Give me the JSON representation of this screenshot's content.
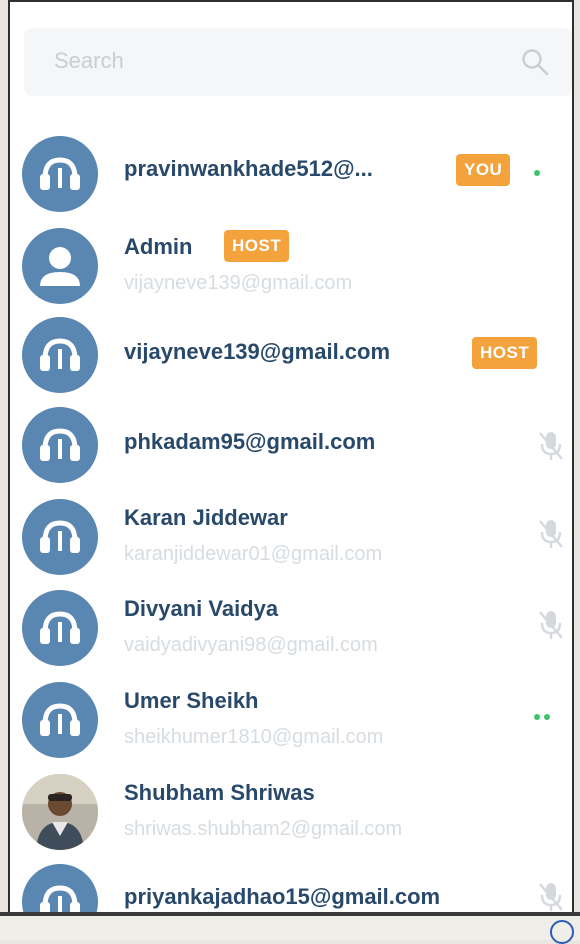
{
  "search": {
    "placeholder": "Search",
    "icon": "search-icon"
  },
  "participants": [
    {
      "name": "pravinwankhade512@...",
      "email": "",
      "badge": "YOU",
      "status": "green-dot",
      "avatar": "headset"
    },
    {
      "name": "Admin",
      "email": "vijayneve139@gmail.com",
      "badge": "HOST",
      "status": "",
      "avatar": "person"
    },
    {
      "name": "vijayneve139@gmail.com",
      "email": "",
      "badge": "HOST",
      "status": "",
      "avatar": "headset"
    },
    {
      "name": "phkadam95@gmail.com",
      "email": "",
      "badge": "",
      "status": "mic-muted",
      "avatar": "headset"
    },
    {
      "name": "Karan Jiddewar",
      "email": "karanjiddewar01@gmail.com",
      "badge": "",
      "status": "mic-muted",
      "avatar": "headset"
    },
    {
      "name": "Divyani Vaidya",
      "email": "vaidyadivyani98@gmail.com",
      "badge": "",
      "status": "mic-muted",
      "avatar": "headset"
    },
    {
      "name": "Umer Sheikh",
      "email": "sheikhumer1810@gmail.com",
      "badge": "",
      "status": "green-dots",
      "avatar": "headset"
    },
    {
      "name": "Shubham Shriwas",
      "email": "shriwas.shubham2@gmail.com",
      "badge": "",
      "status": "",
      "avatar": "photo"
    },
    {
      "name": "priyankajadhao15@gmail.com",
      "email": "",
      "badge": "",
      "status": "mic-muted",
      "avatar": "headset"
    }
  ],
  "colors": {
    "accent": "#5a86b2",
    "name_text": "#29496b",
    "badge": "#f4a23c",
    "online": "#3cc36c"
  }
}
